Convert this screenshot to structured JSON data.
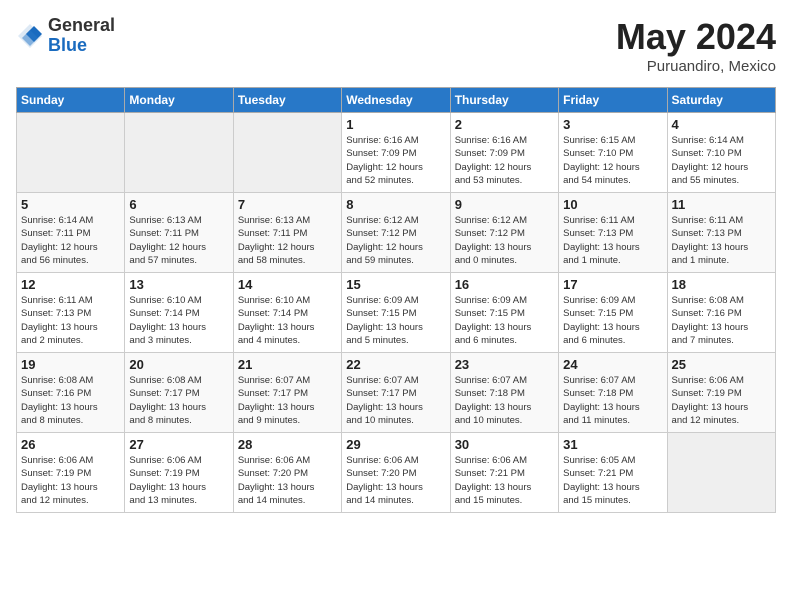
{
  "header": {
    "logo_general": "General",
    "logo_blue": "Blue",
    "month": "May 2024",
    "location": "Puruandiro, Mexico"
  },
  "weekdays": [
    "Sunday",
    "Monday",
    "Tuesday",
    "Wednesday",
    "Thursday",
    "Friday",
    "Saturday"
  ],
  "weeks": [
    [
      {
        "day": "",
        "info": ""
      },
      {
        "day": "",
        "info": ""
      },
      {
        "day": "",
        "info": ""
      },
      {
        "day": "1",
        "info": "Sunrise: 6:16 AM\nSunset: 7:09 PM\nDaylight: 12 hours\nand 52 minutes."
      },
      {
        "day": "2",
        "info": "Sunrise: 6:16 AM\nSunset: 7:09 PM\nDaylight: 12 hours\nand 53 minutes."
      },
      {
        "day": "3",
        "info": "Sunrise: 6:15 AM\nSunset: 7:10 PM\nDaylight: 12 hours\nand 54 minutes."
      },
      {
        "day": "4",
        "info": "Sunrise: 6:14 AM\nSunset: 7:10 PM\nDaylight: 12 hours\nand 55 minutes."
      }
    ],
    [
      {
        "day": "5",
        "info": "Sunrise: 6:14 AM\nSunset: 7:11 PM\nDaylight: 12 hours\nand 56 minutes."
      },
      {
        "day": "6",
        "info": "Sunrise: 6:13 AM\nSunset: 7:11 PM\nDaylight: 12 hours\nand 57 minutes."
      },
      {
        "day": "7",
        "info": "Sunrise: 6:13 AM\nSunset: 7:11 PM\nDaylight: 12 hours\nand 58 minutes."
      },
      {
        "day": "8",
        "info": "Sunrise: 6:12 AM\nSunset: 7:12 PM\nDaylight: 12 hours\nand 59 minutes."
      },
      {
        "day": "9",
        "info": "Sunrise: 6:12 AM\nSunset: 7:12 PM\nDaylight: 13 hours\nand 0 minutes."
      },
      {
        "day": "10",
        "info": "Sunrise: 6:11 AM\nSunset: 7:13 PM\nDaylight: 13 hours\nand 1 minute."
      },
      {
        "day": "11",
        "info": "Sunrise: 6:11 AM\nSunset: 7:13 PM\nDaylight: 13 hours\nand 1 minute."
      }
    ],
    [
      {
        "day": "12",
        "info": "Sunrise: 6:11 AM\nSunset: 7:13 PM\nDaylight: 13 hours\nand 2 minutes."
      },
      {
        "day": "13",
        "info": "Sunrise: 6:10 AM\nSunset: 7:14 PM\nDaylight: 13 hours\nand 3 minutes."
      },
      {
        "day": "14",
        "info": "Sunrise: 6:10 AM\nSunset: 7:14 PM\nDaylight: 13 hours\nand 4 minutes."
      },
      {
        "day": "15",
        "info": "Sunrise: 6:09 AM\nSunset: 7:15 PM\nDaylight: 13 hours\nand 5 minutes."
      },
      {
        "day": "16",
        "info": "Sunrise: 6:09 AM\nSunset: 7:15 PM\nDaylight: 13 hours\nand 6 minutes."
      },
      {
        "day": "17",
        "info": "Sunrise: 6:09 AM\nSunset: 7:15 PM\nDaylight: 13 hours\nand 6 minutes."
      },
      {
        "day": "18",
        "info": "Sunrise: 6:08 AM\nSunset: 7:16 PM\nDaylight: 13 hours\nand 7 minutes."
      }
    ],
    [
      {
        "day": "19",
        "info": "Sunrise: 6:08 AM\nSunset: 7:16 PM\nDaylight: 13 hours\nand 8 minutes."
      },
      {
        "day": "20",
        "info": "Sunrise: 6:08 AM\nSunset: 7:17 PM\nDaylight: 13 hours\nand 8 minutes."
      },
      {
        "day": "21",
        "info": "Sunrise: 6:07 AM\nSunset: 7:17 PM\nDaylight: 13 hours\nand 9 minutes."
      },
      {
        "day": "22",
        "info": "Sunrise: 6:07 AM\nSunset: 7:17 PM\nDaylight: 13 hours\nand 10 minutes."
      },
      {
        "day": "23",
        "info": "Sunrise: 6:07 AM\nSunset: 7:18 PM\nDaylight: 13 hours\nand 10 minutes."
      },
      {
        "day": "24",
        "info": "Sunrise: 6:07 AM\nSunset: 7:18 PM\nDaylight: 13 hours\nand 11 minutes."
      },
      {
        "day": "25",
        "info": "Sunrise: 6:06 AM\nSunset: 7:19 PM\nDaylight: 13 hours\nand 12 minutes."
      }
    ],
    [
      {
        "day": "26",
        "info": "Sunrise: 6:06 AM\nSunset: 7:19 PM\nDaylight: 13 hours\nand 12 minutes."
      },
      {
        "day": "27",
        "info": "Sunrise: 6:06 AM\nSunset: 7:19 PM\nDaylight: 13 hours\nand 13 minutes."
      },
      {
        "day": "28",
        "info": "Sunrise: 6:06 AM\nSunset: 7:20 PM\nDaylight: 13 hours\nand 14 minutes."
      },
      {
        "day": "29",
        "info": "Sunrise: 6:06 AM\nSunset: 7:20 PM\nDaylight: 13 hours\nand 14 minutes."
      },
      {
        "day": "30",
        "info": "Sunrise: 6:06 AM\nSunset: 7:21 PM\nDaylight: 13 hours\nand 15 minutes."
      },
      {
        "day": "31",
        "info": "Sunrise: 6:05 AM\nSunset: 7:21 PM\nDaylight: 13 hours\nand 15 minutes."
      },
      {
        "day": "",
        "info": ""
      }
    ]
  ]
}
